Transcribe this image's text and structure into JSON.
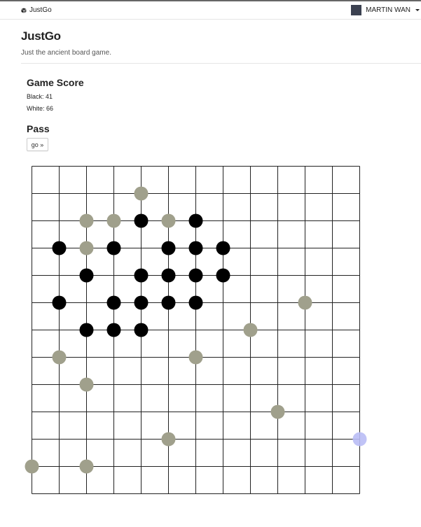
{
  "navbar": {
    "brand": "JustGo",
    "brand_icon": "cube-icon",
    "user_name": "MARTIN WAN"
  },
  "header": {
    "title": "JustGo",
    "subtitle": "Just the ancient board game."
  },
  "score": {
    "heading": "Game Score",
    "black": "Black: 41",
    "white": "White: 66"
  },
  "pass": {
    "heading": "Pass",
    "button_label": "go »"
  },
  "board": {
    "size": 13,
    "colors": {
      "black_stone": "#000000",
      "white_stone": "#a0a08c",
      "hover_marker": "#b9bcf5",
      "grid": "#222222"
    },
    "black_stones": [
      [
        4,
        2
      ],
      [
        6,
        2
      ],
      [
        1,
        3
      ],
      [
        3,
        3
      ],
      [
        5,
        3
      ],
      [
        6,
        3
      ],
      [
        7,
        3
      ],
      [
        2,
        4
      ],
      [
        4,
        4
      ],
      [
        5,
        4
      ],
      [
        6,
        4
      ],
      [
        7,
        4
      ],
      [
        1,
        5
      ],
      [
        3,
        5
      ],
      [
        4,
        5
      ],
      [
        5,
        5
      ],
      [
        6,
        5
      ],
      [
        2,
        6
      ],
      [
        3,
        6
      ],
      [
        4,
        6
      ]
    ],
    "white_stones": [
      [
        4,
        1
      ],
      [
        2,
        2
      ],
      [
        3,
        2
      ],
      [
        5,
        2
      ],
      [
        2,
        3
      ],
      [
        10,
        5
      ],
      [
        8,
        6
      ],
      [
        1,
        7
      ],
      [
        6,
        7
      ],
      [
        2,
        8
      ],
      [
        9,
        9
      ],
      [
        5,
        10
      ],
      [
        0,
        11
      ],
      [
        2,
        11
      ]
    ],
    "hover": [
      12,
      10
    ]
  }
}
